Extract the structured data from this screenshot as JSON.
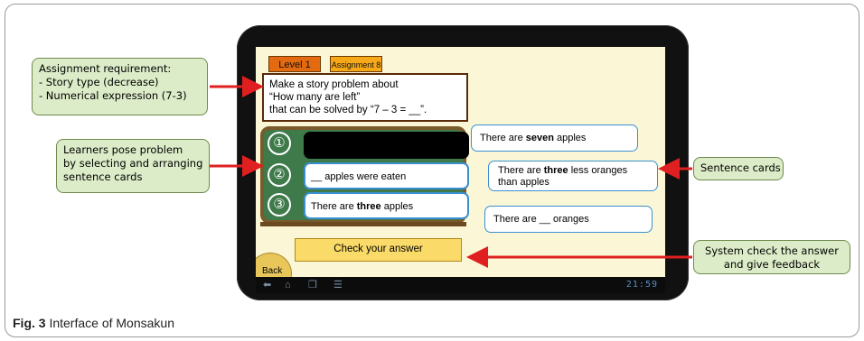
{
  "app": {
    "level_tab": "Level 1",
    "assignment_tab": "Assignment 8",
    "task_lines": [
      "Make a story problem about",
      "“How many are left”",
      "that can be solved by “7 – 3 = __”."
    ],
    "slot_numbers": [
      "①",
      "②",
      "③"
    ],
    "slot2_text": "__ apples were eaten",
    "slot3_pre": "There are ",
    "slot3_bold": "three",
    "slot3_post": "  apples",
    "card1_pre": "There are ",
    "card1_bold": "seven",
    "card1_post": "  apples",
    "card2_pre": "There are ",
    "card2_bold": "three",
    "card2_post": "  less oranges than apples",
    "card3_text": "There are __ oranges",
    "check_button": "Check your answer",
    "back_button": "Back",
    "clock": "21:59"
  },
  "callouts": {
    "assignment": [
      "Assignment requirement:",
      "- Story type (decrease)",
      "- Numerical expression (7-3)"
    ],
    "learners": [
      "Learners pose problem",
      "by selecting and arranging",
      "sentence cards"
    ],
    "sentence_cards": "Sentence cards",
    "system_check": [
      "System check the answer",
      "and give feedback"
    ]
  },
  "caption": {
    "label": "Fig. 3",
    "text": " Interface of Monsakun"
  },
  "colors": {
    "callout_bg": "#dcecc8",
    "arrow": "#e02020",
    "board": "#3f7a4a",
    "screen_bg": "#fbf7d6"
  },
  "icons": [
    "back-nav-icon",
    "home-nav-icon",
    "recent-apps-icon",
    "menu-icon"
  ]
}
